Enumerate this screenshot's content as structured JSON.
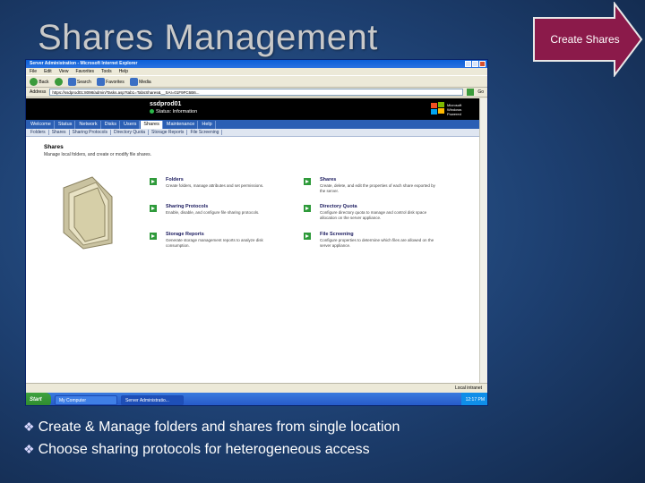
{
  "slide": {
    "title": "Shares Management",
    "callout": "Create Shares",
    "bullets": [
      "Create & Manage folders and shares from single location",
      "Choose sharing protocols for heterogeneous access"
    ]
  },
  "browser": {
    "window_title": "Server Administration - Microsoft Internet Explorer",
    "menu": [
      "File",
      "Edit",
      "View",
      "Favorites",
      "Tools",
      "Help"
    ],
    "toolbar": {
      "back": "Back",
      "search": "Search",
      "favorites": "Favorites",
      "media": "Media"
    },
    "address_label": "Address",
    "address_value": "https://ssdprod01:8098/admin/Tasks.asp?tab1=TabsShares&__SAI=01F9FC6B6...",
    "go_label": "Go",
    "status_zone": "Local intranet"
  },
  "server": {
    "name": "ssdprod01",
    "status": "Status: Information",
    "brand_lines": [
      "Microsoft",
      "Windows",
      "Powered"
    ]
  },
  "nav_tabs": [
    "Welcome",
    "Status",
    "Network",
    "Disks",
    "Users",
    "Shares",
    "Maintenance",
    "Help"
  ],
  "active_tab": "Shares",
  "subnav": [
    "Folders",
    "Shares",
    "Sharing Protocols",
    "Directory Quota",
    "Storage Reports",
    "File Screening"
  ],
  "page": {
    "heading": "Shares",
    "description": "Manage local folders, and create or modify file shares."
  },
  "tasks": [
    {
      "title": "Folders",
      "desc": "Create folders, manage attributes and set permissions."
    },
    {
      "title": "Shares",
      "desc": "Create, delete, and edit the properties of each share exported by the server."
    },
    {
      "title": "Sharing Protocols",
      "desc": "Enable, disable, and configure file sharing protocols."
    },
    {
      "title": "Directory Quota",
      "desc": "Configure directory quota to manage and control disk space allocation on the server appliance."
    },
    {
      "title": "Storage Reports",
      "desc": "Generate storage management reports to analyze disk consumption."
    },
    {
      "title": "File Screening",
      "desc": "Configure properties to determine which files are allowed on the server appliance."
    }
  ],
  "taskbar": {
    "start": "Start",
    "items": [
      "My Computer",
      "Server Administratio..."
    ],
    "clock": "12:17 PM"
  },
  "colors": {
    "nav_blue": "#2b5fb4",
    "callout_fill": "#8b1a4a",
    "bg": "#1d3f70"
  }
}
